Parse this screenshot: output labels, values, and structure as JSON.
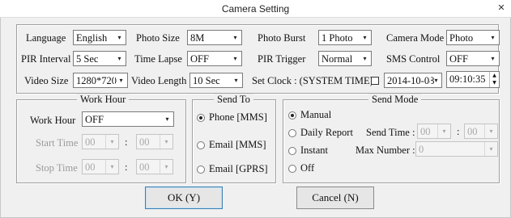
{
  "window": {
    "title": "Camera Setting",
    "close_glyph": "✕"
  },
  "settings": {
    "language": {
      "label": "Language",
      "value": "English"
    },
    "photo_size": {
      "label": "Photo Size",
      "value": "8M"
    },
    "photo_burst": {
      "label": "Photo Burst",
      "value": "1 Photo"
    },
    "camera_mode": {
      "label": "Camera Mode",
      "value": "Photo"
    },
    "pir_interval": {
      "label": "PIR Interval",
      "value": "5 Sec"
    },
    "time_lapse": {
      "label": "Time Lapse",
      "value": "OFF"
    },
    "pir_trigger": {
      "label": "PIR Trigger",
      "value": "Normal"
    },
    "sms_control": {
      "label": "SMS Control",
      "value": "OFF"
    },
    "video_size": {
      "label": "Video Size",
      "value": "1280*720"
    },
    "video_length": {
      "label": "Video Length",
      "value": "10 Sec"
    },
    "set_clock": {
      "label": "Set Clock : (SYSTEM TIME)",
      "checked": false,
      "date": "2014-10-08",
      "time": "09:10:35"
    }
  },
  "work_hour": {
    "title": "Work Hour",
    "work_hour_label": "Work Hour",
    "work_hour_value": "OFF",
    "start_label": "Start Time",
    "start_hour": "00",
    "start_min": "00",
    "stop_label": "Stop Time",
    "stop_hour": "00",
    "stop_min": "00",
    "colon": ":"
  },
  "send_to": {
    "title": "Send To",
    "options": [
      "Phone [MMS]",
      "Email [MMS]",
      "Email [GPRS]"
    ],
    "selected": 0
  },
  "send_mode": {
    "title": "Send Mode",
    "options": [
      "Manual",
      "Daily Report",
      "Instant",
      "Off"
    ],
    "selected": 0,
    "send_time_label": "Send Time :",
    "send_hour": "00",
    "send_min": "00",
    "colon": ":",
    "max_number_label": "Max Number :",
    "max_number_value": "0"
  },
  "buttons": {
    "ok": "OK (Y)",
    "cancel": "Cancel (N)"
  },
  "icons": {
    "dropdown": "chevron-down-icon",
    "spin_up": "▲",
    "spin_down": "▼",
    "arrow": "▾"
  }
}
